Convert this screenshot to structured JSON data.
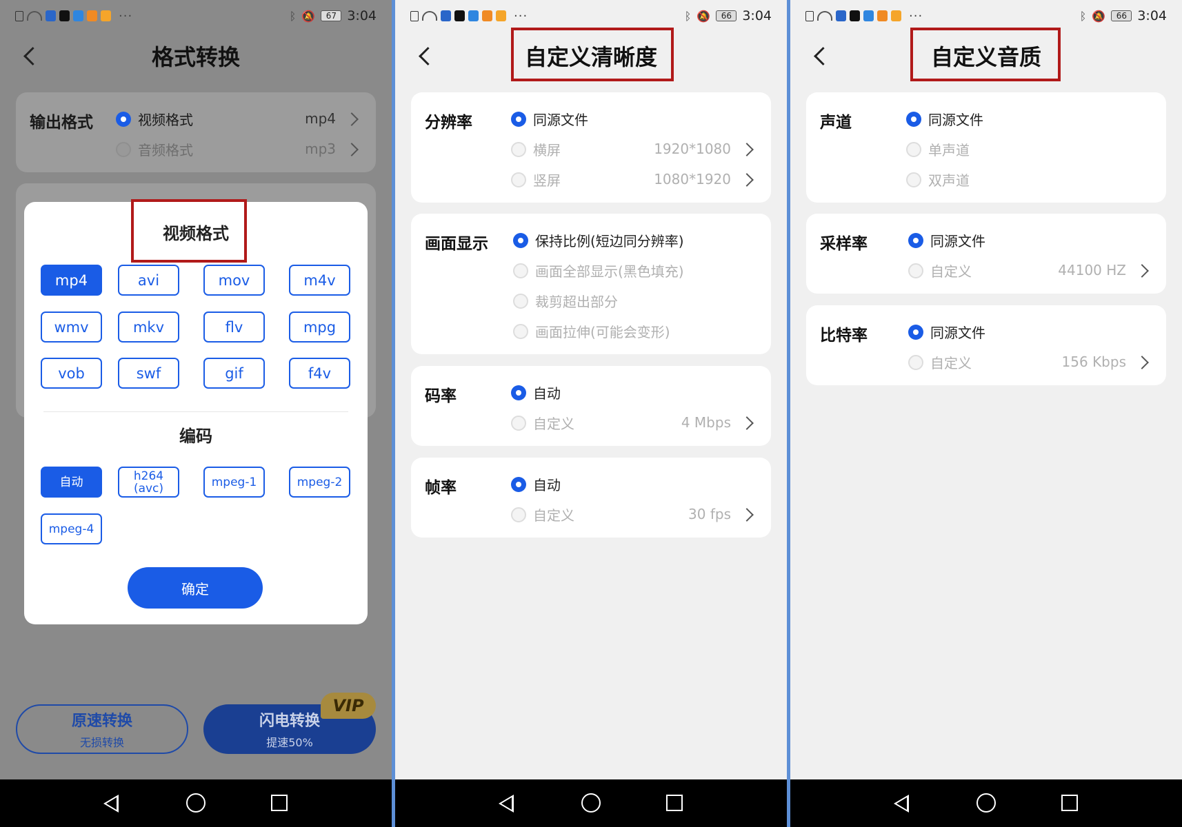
{
  "status": {
    "time": "3:04",
    "p1_battery": "67",
    "p2_battery": "66",
    "p3_battery": "66",
    "dots": "···"
  },
  "p1": {
    "title": "格式转换",
    "output_label": "输出格式",
    "video_fmt_label": "视频格式",
    "video_fmt_value": "mp4",
    "audio_fmt_label": "音频格式",
    "audio_fmt_value": "mp3",
    "dialog": {
      "title": "视频格式",
      "formats": [
        "mp4",
        "avi",
        "mov",
        "m4v",
        "wmv",
        "mkv",
        "flv",
        "mpg",
        "vob",
        "swf",
        "gif",
        "f4v"
      ],
      "encode_title": "编码",
      "codecs": [
        "自动",
        "h264\n(avc)",
        "mpeg-1",
        "mpeg-2",
        "mpeg-4"
      ],
      "confirm": "确定"
    },
    "btn_normal": {
      "main": "原速转换",
      "sub": "无损转换"
    },
    "btn_fast": {
      "main": "闪电转换",
      "sub": "提速50%"
    },
    "vip": "VIP"
  },
  "p2": {
    "title": "自定义清晰度",
    "resolution": {
      "label": "分辨率",
      "opt1": "同源文件",
      "opt2": "横屏",
      "opt2_val": "1920*1080",
      "opt3": "竖屏",
      "opt3_val": "1080*1920"
    },
    "display": {
      "label": "画面显示",
      "opt1": "保持比例(短边同分辨率)",
      "opt2": "画面全部显示(黑色填充)",
      "opt3": "裁剪超出部分",
      "opt4": "画面拉伸(可能会变形)"
    },
    "bitrate": {
      "label": "码率",
      "opt1": "自动",
      "opt2": "自定义",
      "opt2_val": "4 Mbps"
    },
    "framerate": {
      "label": "帧率",
      "opt1": "自动",
      "opt2": "自定义",
      "opt2_val": "30 fps"
    }
  },
  "p3": {
    "title": "自定义音质",
    "channel": {
      "label": "声道",
      "opt1": "同源文件",
      "opt2": "单声道",
      "opt3": "双声道"
    },
    "samplerate": {
      "label": "采样率",
      "opt1": "同源文件",
      "opt2": "自定义",
      "opt2_val": "44100 HZ"
    },
    "bitrate": {
      "label": "比特率",
      "opt1": "同源文件",
      "opt2": "自定义",
      "opt2_val": "156 Kbps"
    }
  }
}
